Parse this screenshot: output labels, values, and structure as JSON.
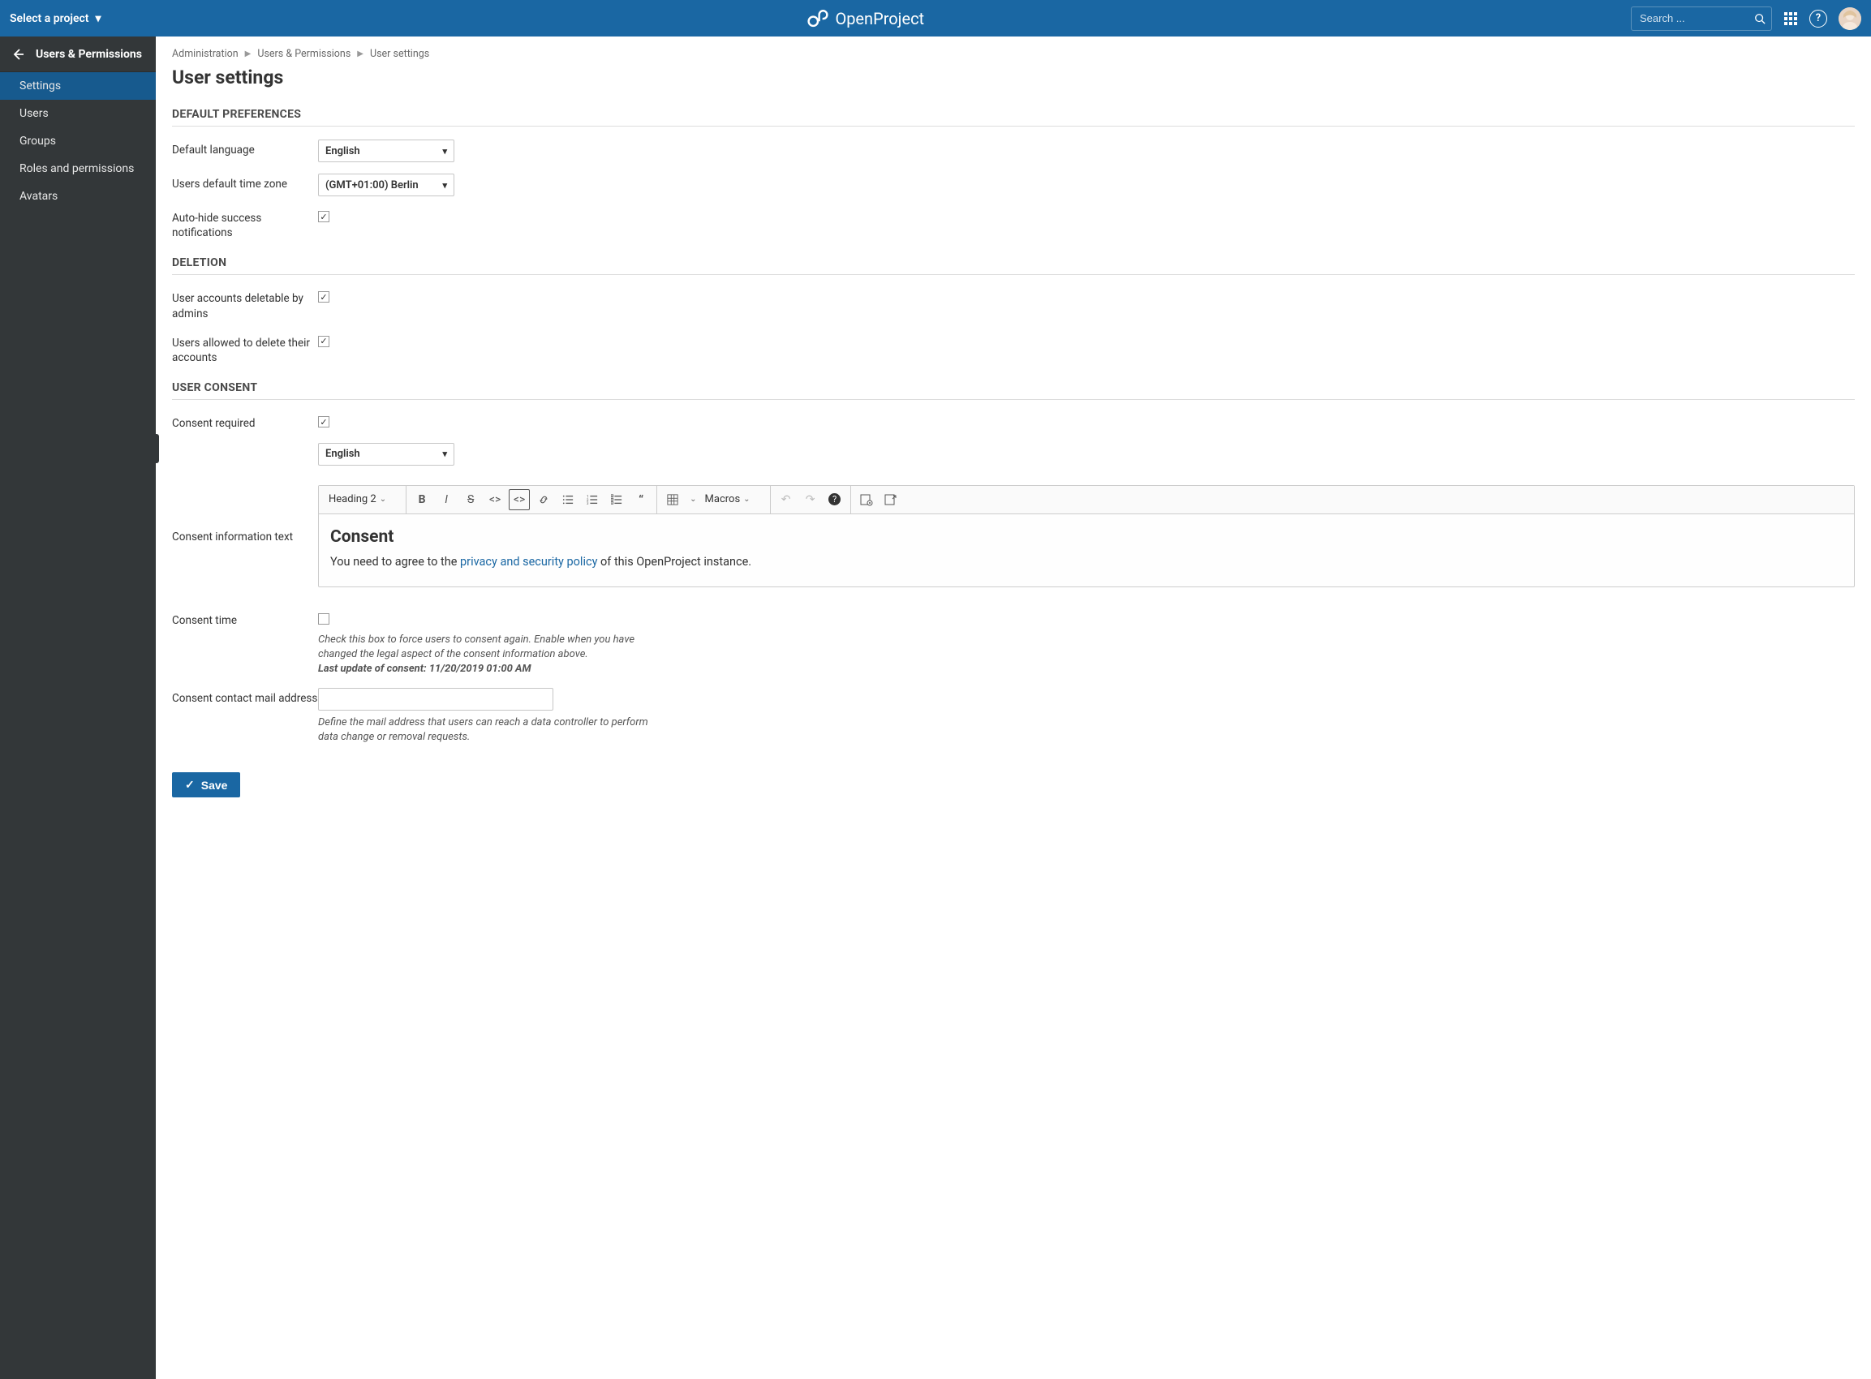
{
  "topbar": {
    "project_select": "Select a project",
    "logo_text": "OpenProject",
    "search_placeholder": "Search ..."
  },
  "sidebar": {
    "title": "Users & Permissions",
    "items": [
      {
        "label": "Settings"
      },
      {
        "label": "Users"
      },
      {
        "label": "Groups"
      },
      {
        "label": "Roles and permissions"
      },
      {
        "label": "Avatars"
      }
    ]
  },
  "breadcrumb": {
    "a": "Administration",
    "b": "Users & Permissions",
    "c": "User settings"
  },
  "page_title": "User settings",
  "sections": {
    "default_prefs": "DEFAULT PREFERENCES",
    "deletion": "DELETION",
    "user_consent": "USER CONSENT"
  },
  "labels": {
    "default_language": "Default language",
    "default_timezone": "Users default time zone",
    "auto_hide": "Auto-hide success notifications",
    "deletable_admins": "User accounts deletable by admins",
    "users_delete_own": "Users allowed to delete their accounts",
    "consent_required": "Consent required",
    "consent_info_text": "Consent information text",
    "consent_time": "Consent time",
    "consent_contact": "Consent contact mail address"
  },
  "values": {
    "default_language": "English",
    "default_timezone": "(GMT+01:00) Berlin",
    "consent_lang": "English"
  },
  "editor": {
    "heading_select": "Heading 2",
    "macros": "Macros",
    "content_heading": "Consent",
    "content_prefix": "You need to agree to the ",
    "content_link": "privacy and security policy",
    "content_suffix": " of this OpenProject instance."
  },
  "consent_time_help_1": "Check this box to force users to consent again. Enable when you have changed the legal aspect of the consent information above.",
  "consent_time_help_2a": "Last update of consent: ",
  "consent_time_help_2b": "11/20/2019 01:00 AM",
  "consent_contact_help": "Define the mail address that users can reach a data controller to perform data change or removal requests.",
  "save_label": "Save"
}
